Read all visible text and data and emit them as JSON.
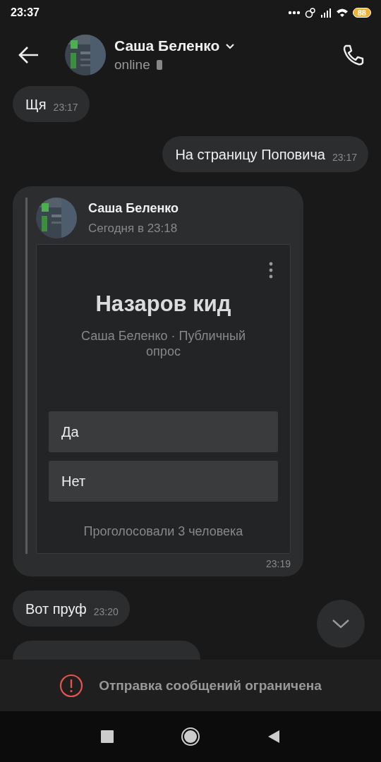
{
  "status_bar": {
    "time": "23:37",
    "battery": "88"
  },
  "header": {
    "name": "Саша Беленко",
    "status": "online"
  },
  "messages": [
    {
      "kind": "text",
      "outgoing": false,
      "text": "Щя",
      "time": "23:17"
    },
    {
      "kind": "text",
      "outgoing": true,
      "text": "На страницу Поповича",
      "time": "23:17"
    },
    {
      "kind": "repost",
      "outgoing": false,
      "author": "Саша Беленко",
      "date": "Сегодня в 23:18",
      "poll": {
        "title": "Назаров кид",
        "subtitle": "Саша Беленко · Публичный опрос",
        "options": [
          {
            "label": "Да"
          },
          {
            "label": "Нет"
          }
        ],
        "votes": "Проголосовали 3 человека"
      },
      "time": "23:19"
    },
    {
      "kind": "text",
      "outgoing": false,
      "text": "Вот пруф",
      "time": "23:20"
    },
    {
      "kind": "cut",
      "outgoing": false
    }
  ],
  "notice": "Отправка сообщений ограничена"
}
